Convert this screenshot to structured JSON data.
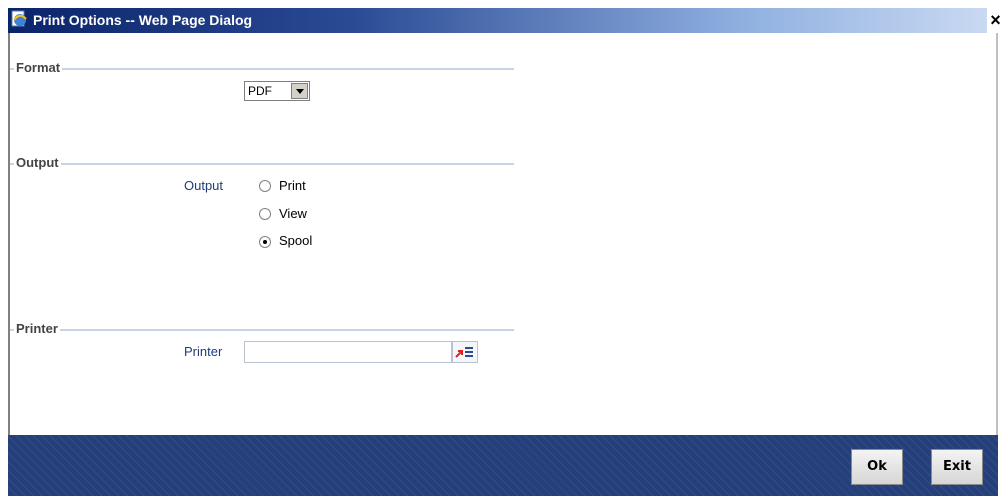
{
  "window": {
    "title": "Print Options -- Web Page Dialog",
    "icon": "ie-page-icon",
    "close_label": "×"
  },
  "sections": {
    "format": {
      "label": "Format",
      "select_value": "PDF"
    },
    "output": {
      "label": "Output",
      "field_label": "Output",
      "options": [
        {
          "label": "Print",
          "checked": false
        },
        {
          "label": "View",
          "checked": false
        },
        {
          "label": "Spool",
          "checked": true
        }
      ]
    },
    "printer": {
      "label": "Printer",
      "field_label": "Printer",
      "value": ""
    }
  },
  "footer": {
    "ok_label": "Ok",
    "exit_label": "Exit"
  },
  "colors": {
    "title_bar": "#0a246a",
    "field_label": "#1f3c78",
    "footer": "#243f7a"
  }
}
